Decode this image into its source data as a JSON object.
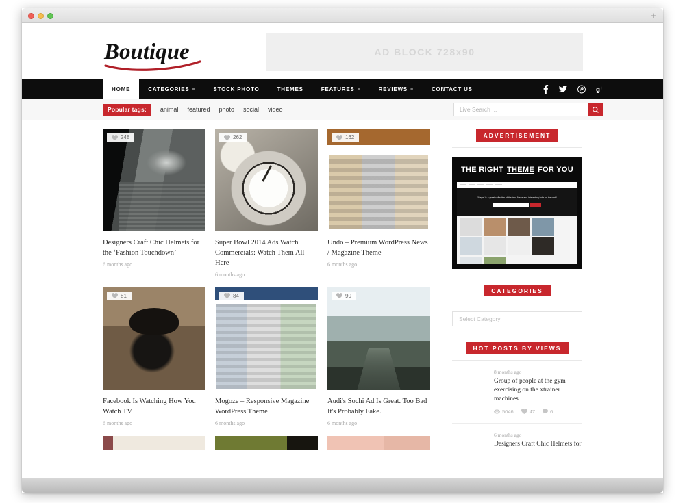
{
  "browser": {
    "new_tab_label": "+"
  },
  "header": {
    "logo_text": "Boutique",
    "ad_label": "AD BLOCK 728x90"
  },
  "nav": {
    "items": [
      {
        "label": "HOME",
        "has_caret": false,
        "active": true
      },
      {
        "label": "CATEGORIES",
        "has_caret": true,
        "active": false
      },
      {
        "label": "STOCK PHOTO",
        "has_caret": false,
        "active": false
      },
      {
        "label": "THEMES",
        "has_caret": false,
        "active": false
      },
      {
        "label": "FEATURES",
        "has_caret": true,
        "active": false
      },
      {
        "label": "REVIEWS",
        "has_caret": true,
        "active": false
      },
      {
        "label": "CONTACT US",
        "has_caret": false,
        "active": false
      }
    ],
    "social": [
      "facebook-icon",
      "twitter-icon",
      "pinterest-icon",
      "googleplus-icon"
    ]
  },
  "tagbar": {
    "badge_label": "Popular tags:",
    "tags": [
      "animal",
      "featured",
      "photo",
      "social",
      "video"
    ],
    "search_placeholder": "Live Search ...",
    "search_value": ""
  },
  "posts": [
    {
      "title": "Designers Craft Chic Helmets for the ‘Fashion Touchdown’",
      "date": "6 months ago",
      "likes": "248",
      "art": "art-helmet"
    },
    {
      "title": "Super Bowl 2014 Ads Watch Commercials: Watch Them All Here",
      "date": "6 months ago",
      "likes": "262",
      "art": "art-clock"
    },
    {
      "title": "Undo – Premium WordPress News / Magazine Theme",
      "date": "6 months ago",
      "likes": "162",
      "art": "art-undo"
    },
    {
      "title": "Facebook Is Watching How You Watch TV",
      "date": "6 months ago",
      "likes": "81",
      "art": "art-dog"
    },
    {
      "title": "Mogoze – Responsive Magazine WordPress Theme",
      "date": "6 months ago",
      "likes": "84",
      "art": "art-mogoze"
    },
    {
      "title": "Audi's Sochi Ad Is Great. Too Bad It's Probably Fake.",
      "date": "6 months ago",
      "likes": "90",
      "art": "art-audi"
    }
  ],
  "sidebar": {
    "advertisement": {
      "title": "ADVERTISEMENT",
      "banner_pre": "THE RIGHT",
      "banner_em": "THEME",
      "banner_post": "FOR YOU",
      "banner_tagline": "“Page” is a great collection of the best News and interesting links on the web!"
    },
    "categories": {
      "title": "CATEGORIES",
      "select_placeholder": "Select Category"
    },
    "hot_posts": {
      "title": "HOT POSTS BY VIEWS",
      "items": [
        {
          "date": "8 months ago",
          "title": "Group of people at the gym exercising on the xtrainer machines",
          "views": "5046",
          "likes": "47",
          "comments": "6",
          "art": "art-gym"
        },
        {
          "date": "6 months ago",
          "title": "Designers Craft Chic Helmets for",
          "views": "",
          "likes": "",
          "comments": "",
          "art": "art-helmet-sm"
        }
      ]
    }
  },
  "colors": {
    "accent": "#c8272d",
    "nav_bg": "#0d0d0d",
    "tagbar_bg": "#f7f7f7"
  }
}
